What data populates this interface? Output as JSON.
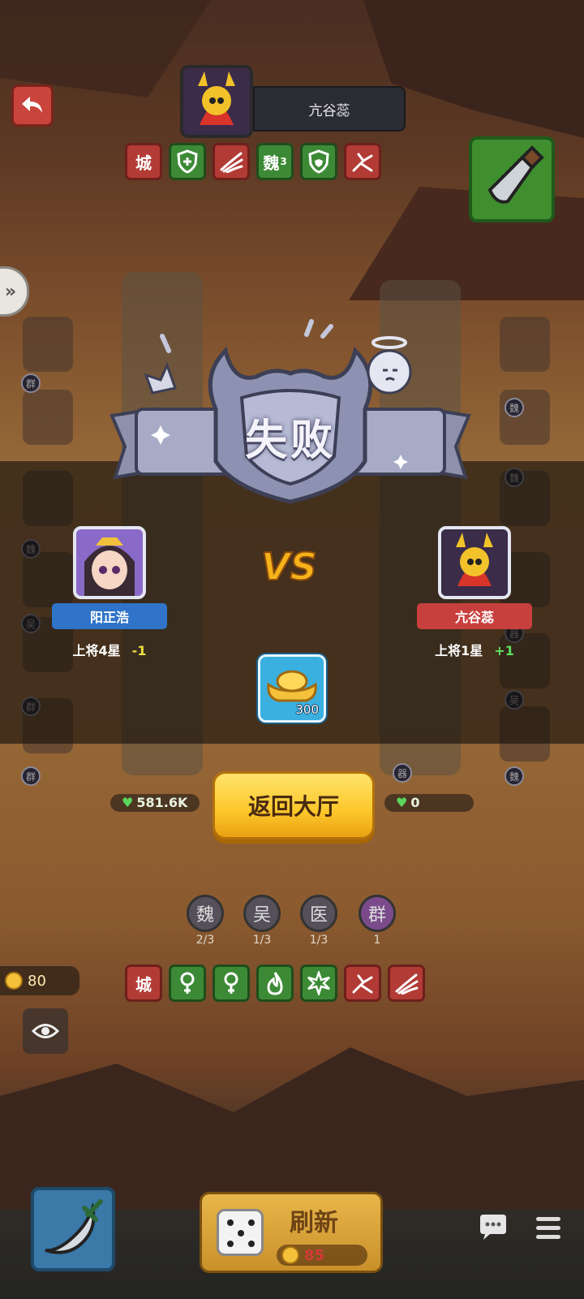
{
  "header": {
    "opponent_name": "亢谷蕊",
    "opponent_tags": [
      {
        "type": "text",
        "label": "城",
        "color": "red"
      },
      {
        "type": "icon",
        "icon": "shield-plus-icon",
        "color": "green"
      },
      {
        "type": "icon",
        "icon": "claw-slash-icon",
        "color": "red"
      },
      {
        "type": "text",
        "label": "魏",
        "sub": "3",
        "color": "green"
      },
      {
        "type": "icon",
        "icon": "shield-icon",
        "color": "green"
      },
      {
        "type": "icon",
        "icon": "arrow-strike-icon",
        "color": "red"
      }
    ]
  },
  "result": {
    "title": "失败",
    "vs_label": "VS",
    "left_player": {
      "name": "阳正浩",
      "rank": "上将4星",
      "delta": "-1",
      "name_color": "#2f74c8",
      "delta_color": "#f0e040"
    },
    "right_player": {
      "name": "亢谷蕊",
      "rank": "上将1星",
      "delta": "+1",
      "name_color": "#c8403e",
      "delta_color": "#5ee05e"
    },
    "reward": {
      "icon": "gold-ingot-icon",
      "amount": "300"
    },
    "return_button": "返回大厅"
  },
  "board": {
    "left_hp": "581.6K",
    "right_hp": "0",
    "left_unit_badges": [
      "群",
      "魏",
      "吴",
      "群",
      "群"
    ],
    "right_unit_badges": [
      "魏",
      "魏",
      "器",
      "吴",
      "魏",
      "器"
    ]
  },
  "factions": [
    {
      "label": "魏",
      "count": "2/3"
    },
    {
      "label": "吴",
      "count": "1/3"
    },
    {
      "label": "医",
      "count": "1/3"
    },
    {
      "label": "群",
      "count": "1"
    }
  ],
  "my_tags": [
    {
      "type": "text",
      "label": "城",
      "color": "red"
    },
    {
      "type": "icon",
      "icon": "keyhole-icon",
      "color": "green"
    },
    {
      "type": "icon",
      "icon": "keyhole-icon",
      "color": "green"
    },
    {
      "type": "icon",
      "icon": "flame-icon",
      "color": "green"
    },
    {
      "type": "icon",
      "icon": "burst-icon",
      "color": "green"
    },
    {
      "type": "icon",
      "icon": "arrow-strike-icon",
      "color": "red"
    },
    {
      "type": "icon",
      "icon": "claw-slash-icon",
      "color": "red"
    }
  ],
  "bottom": {
    "coins": "80",
    "refresh_label": "刷新",
    "refresh_cost": "85"
  }
}
